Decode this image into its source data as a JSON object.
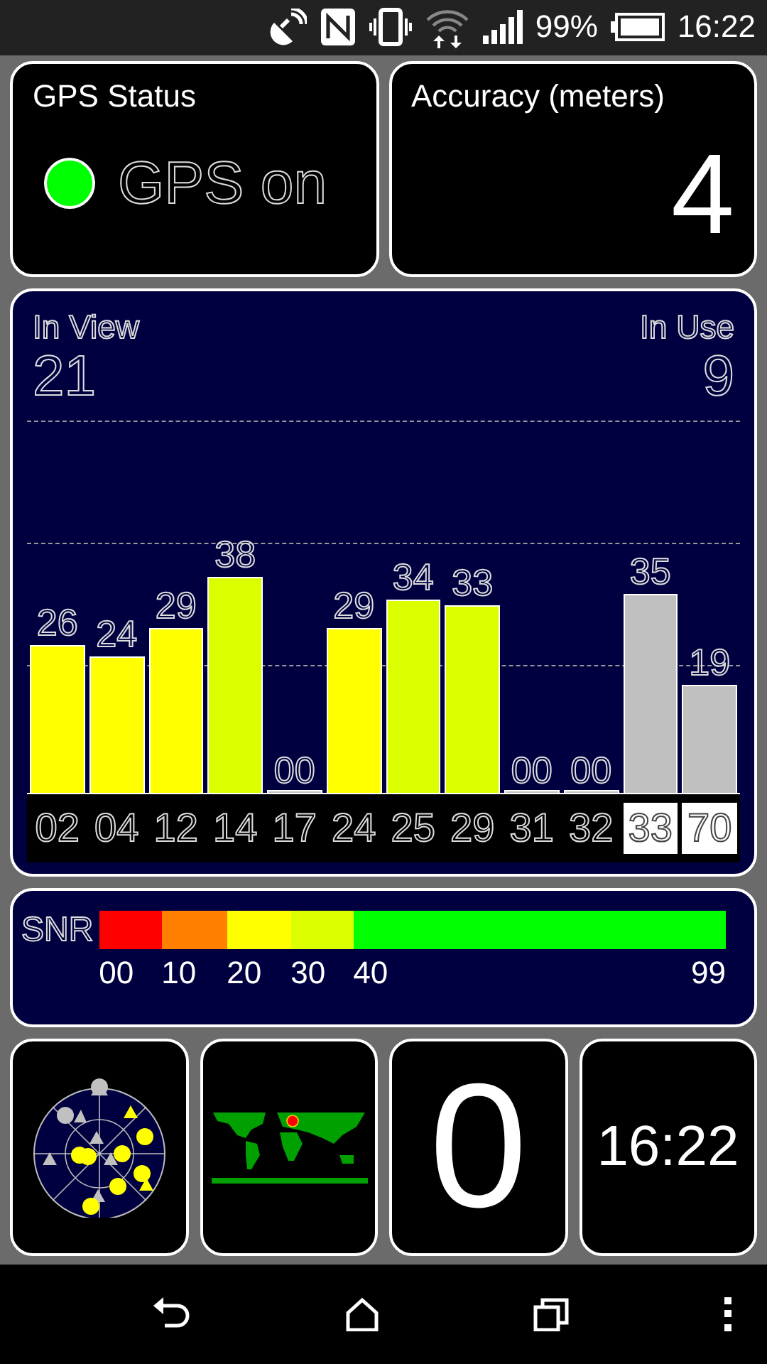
{
  "status_bar": {
    "battery": "99%",
    "time": "16:22"
  },
  "gps_status": {
    "title": "GPS Status",
    "on": true,
    "text": "GPS on"
  },
  "accuracy": {
    "title": "Accuracy (meters)",
    "value": "4"
  },
  "satellites": {
    "in_view_label": "In View",
    "in_view": "21",
    "in_use_label": "In Use",
    "in_use": "9",
    "bars": [
      {
        "id": "02",
        "snr": "26",
        "color": "#ffff00",
        "highlighted": false
      },
      {
        "id": "04",
        "snr": "24",
        "color": "#ffff00",
        "highlighted": false
      },
      {
        "id": "12",
        "snr": "29",
        "color": "#ffff00",
        "highlighted": false
      },
      {
        "id": "14",
        "snr": "38",
        "color": "#dcff00",
        "highlighted": false
      },
      {
        "id": "17",
        "snr": "00",
        "color": "#c0c0c0",
        "highlighted": false
      },
      {
        "id": "24",
        "snr": "29",
        "color": "#ffff00",
        "highlighted": false
      },
      {
        "id": "25",
        "snr": "34",
        "color": "#dcff00",
        "highlighted": false
      },
      {
        "id": "29",
        "snr": "33",
        "color": "#dcff00",
        "highlighted": false
      },
      {
        "id": "31",
        "snr": "00",
        "color": "#c0c0c0",
        "highlighted": false
      },
      {
        "id": "32",
        "snr": "00",
        "color": "#c0c0c0",
        "highlighted": false
      },
      {
        "id": "33",
        "snr": "35",
        "color": "#c0c0c0",
        "highlighted": true
      },
      {
        "id": "70",
        "snr": "19",
        "color": "#c0c0c0",
        "highlighted": true
      }
    ]
  },
  "snr_scale": {
    "label": "SNR",
    "segments": [
      {
        "color": "#ff0000",
        "tick": "00"
      },
      {
        "color": "#ff8000",
        "tick": "10"
      },
      {
        "color": "#ffff00",
        "tick": "20"
      },
      {
        "color": "#dcff00",
        "tick": "30"
      },
      {
        "color": "#00ff00",
        "tick": "40"
      }
    ],
    "end_tick": "99"
  },
  "tiles": {
    "count": "0",
    "clock": "16:22"
  }
}
